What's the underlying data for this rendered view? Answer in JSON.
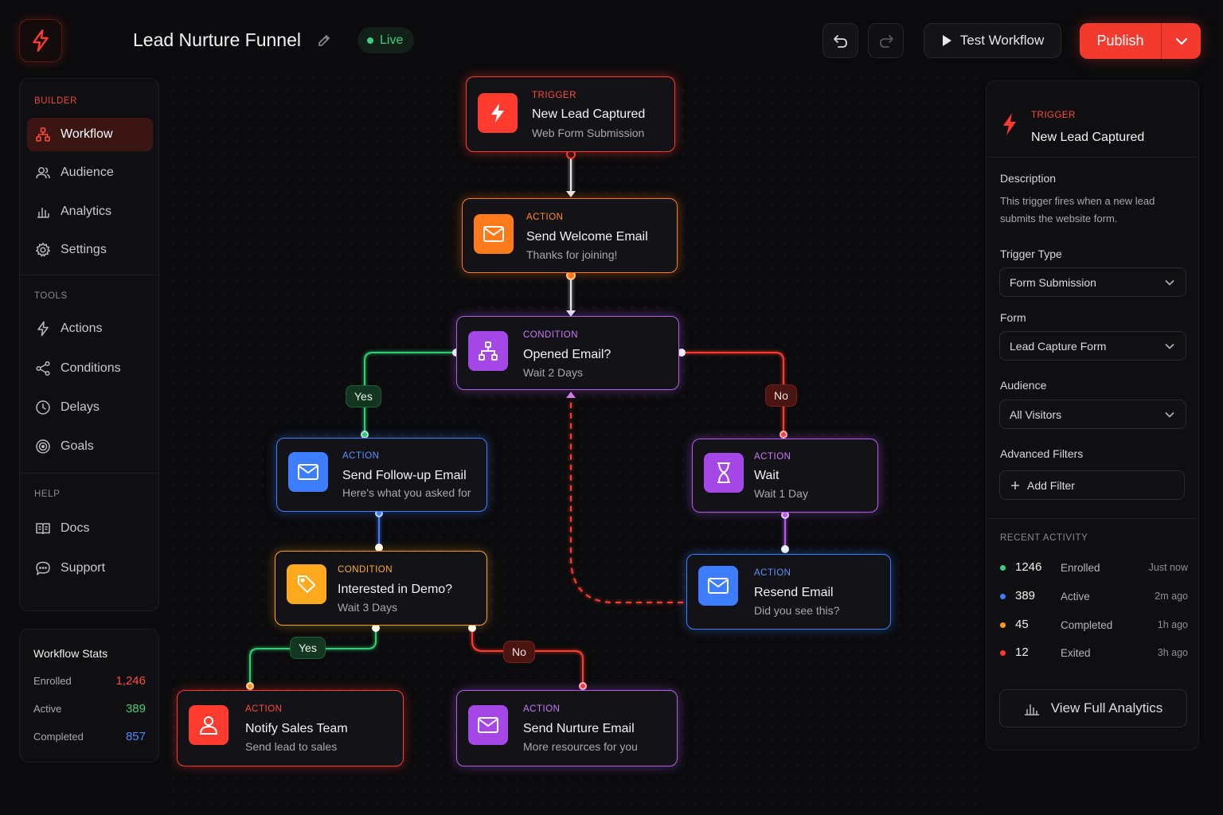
{
  "header": {
    "title": "Lead Nurture Funnel",
    "status": "Live",
    "test_label": "Test Workflow",
    "publish_label": "Publish"
  },
  "sidebar": {
    "builder_label": "BUILDER",
    "builder_items": [
      {
        "label": "Workflow",
        "icon": "workflow-icon",
        "active": true
      },
      {
        "label": "Audience",
        "icon": "users-icon"
      },
      {
        "label": "Analytics",
        "icon": "bar-chart-icon"
      },
      {
        "label": "Settings",
        "icon": "gear-icon"
      }
    ],
    "tools_label": "TOOLS",
    "tools_items": [
      {
        "label": "Actions",
        "icon": "bolt-icon"
      },
      {
        "label": "Conditions",
        "icon": "share-icon"
      },
      {
        "label": "Delays",
        "icon": "clock-icon"
      },
      {
        "label": "Goals",
        "icon": "target-icon"
      }
    ],
    "help_label": "HELP",
    "help_items": [
      {
        "label": "Docs",
        "icon": "book-icon"
      },
      {
        "label": "Support",
        "icon": "chat-icon"
      }
    ]
  },
  "stats": {
    "title": "Workflow Stats",
    "rows": [
      {
        "label": "Enrolled",
        "value": "1,246",
        "color": "#ff4a3d"
      },
      {
        "label": "Active",
        "value": "389",
        "color": "#3ccf7e"
      },
      {
        "label": "Completed",
        "value": "857",
        "color": "#4a8cff"
      }
    ]
  },
  "nodes": {
    "trigger": {
      "tag": "TRIGGER",
      "title": "New Lead Captured",
      "sub": "Web Form Submission",
      "color": "#ff3b2f"
    },
    "welcome": {
      "tag": "ACTION",
      "title": "Send Welcome Email",
      "sub": "Thanks for joining!",
      "color": "#ff7a1a"
    },
    "opened": {
      "tag": "CONDITION",
      "title": "Opened Email?",
      "sub": "Wait 2 Days",
      "color": "#b45cf0"
    },
    "followup": {
      "tag": "ACTION",
      "title": "Send Follow-up Email",
      "sub": "Here's what you asked for",
      "color": "#3d7dff"
    },
    "wait": {
      "tag": "ACTION",
      "title": "Wait",
      "sub": "Wait 1 Day",
      "color": "#b45cf0"
    },
    "resend": {
      "tag": "ACTION",
      "title": "Resend Email",
      "sub": "Did you see this?",
      "color": "#3d7dff"
    },
    "demo": {
      "tag": "CONDITION",
      "title": "Interested in Demo?",
      "sub": "Wait 3 Days",
      "color": "#ffa21a"
    },
    "notify": {
      "tag": "ACTION",
      "title": "Notify Sales Team",
      "sub": "Send lead to sales",
      "color": "#ff3b2f"
    },
    "nurture": {
      "tag": "ACTION",
      "title": "Send Nurture Email",
      "sub": "More resources for you",
      "color": "#b45cf0"
    }
  },
  "branches": {
    "yes1": "Yes",
    "no1": "No",
    "yes2": "Yes",
    "no2": "No"
  },
  "panel": {
    "tag": "TRIGGER",
    "title": "New Lead Captured",
    "description_label": "Description",
    "description_line1": "This trigger fires when a new lead",
    "description_line2": "submits the website form.",
    "trigger_type_label": "Trigger Type",
    "trigger_type_value": "Form Submission",
    "form_label": "Form",
    "form_value": "Lead Capture Form",
    "audience_label": "Audience",
    "audience_value": "All Visitors",
    "filters_label": "Advanced Filters",
    "add_filter_label": "Add Filter",
    "activity_label": "RECENT ACTIVITY",
    "activity": [
      {
        "count": "1246",
        "label": "Enrolled",
        "time": "Just now",
        "color": "#3ccf7e"
      },
      {
        "count": "389",
        "label": "Active",
        "time": "2m ago",
        "color": "#3d7dff"
      },
      {
        "count": "45",
        "label": "Completed",
        "time": "1h ago",
        "color": "#ff9a1a"
      },
      {
        "count": "12",
        "label": "Exited",
        "time": "3h ago",
        "color": "#ff3b2f"
      }
    ],
    "view_analytics_label": "View Full Analytics"
  }
}
